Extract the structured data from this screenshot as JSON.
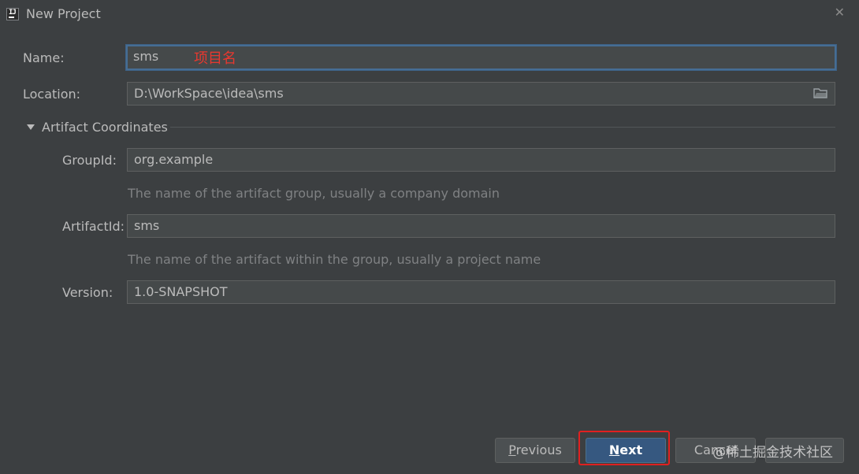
{
  "window": {
    "title": "New Project",
    "close_glyph": "✕"
  },
  "form": {
    "name_label": "Name:",
    "name_value": "sms",
    "name_annotation": "项目名",
    "location_label": "Location:",
    "location_value": "D:\\WorkSpace\\idea\\sms",
    "section_title": "Artifact Coordinates",
    "groupid_label": "GroupId:",
    "groupid_value": "org.example",
    "groupid_hint": "The name of the artifact group, usually a company domain",
    "artifactid_label": "ArtifactId:",
    "artifactid_value": "sms",
    "artifactid_hint": "The name of the artifact within the group, usually a project name",
    "version_label": "Version:",
    "version_value": "1.0-SNAPSHOT"
  },
  "buttons": {
    "previous_mnemonic": "P",
    "previous_rest": "revious",
    "next_mnemonic": "N",
    "next_rest": "ext",
    "cancel_label": "Cancel"
  },
  "watermark": "@稀土掘金技术社区",
  "colors": {
    "background": "#3c3f41",
    "field": "#45494a",
    "focus_border": "#466d94",
    "primary_button": "#365880",
    "annotation_red": "#e8382f"
  },
  "icons": [
    "app-icon",
    "close-icon",
    "folder-icon",
    "collapse-triangle-icon"
  ]
}
